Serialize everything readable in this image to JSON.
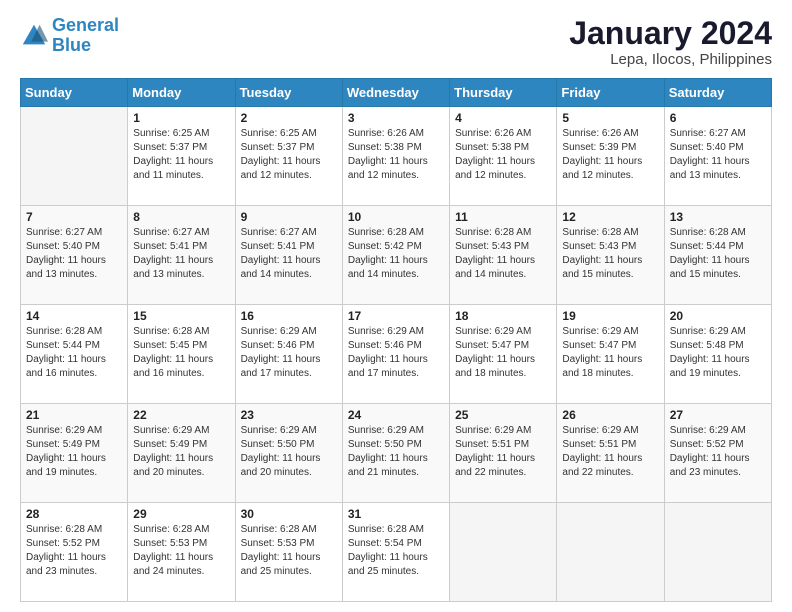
{
  "logo": {
    "line1": "General",
    "line2": "Blue"
  },
  "title": "January 2024",
  "subtitle": "Lepa, Ilocos, Philippines",
  "days_header": [
    "Sunday",
    "Monday",
    "Tuesday",
    "Wednesday",
    "Thursday",
    "Friday",
    "Saturday"
  ],
  "weeks": [
    [
      {
        "day": "",
        "content": ""
      },
      {
        "day": "1",
        "content": "Sunrise: 6:25 AM\nSunset: 5:37 PM\nDaylight: 11 hours\nand 11 minutes."
      },
      {
        "day": "2",
        "content": "Sunrise: 6:25 AM\nSunset: 5:37 PM\nDaylight: 11 hours\nand 12 minutes."
      },
      {
        "day": "3",
        "content": "Sunrise: 6:26 AM\nSunset: 5:38 PM\nDaylight: 11 hours\nand 12 minutes."
      },
      {
        "day": "4",
        "content": "Sunrise: 6:26 AM\nSunset: 5:38 PM\nDaylight: 11 hours\nand 12 minutes."
      },
      {
        "day": "5",
        "content": "Sunrise: 6:26 AM\nSunset: 5:39 PM\nDaylight: 11 hours\nand 12 minutes."
      },
      {
        "day": "6",
        "content": "Sunrise: 6:27 AM\nSunset: 5:40 PM\nDaylight: 11 hours\nand 13 minutes."
      }
    ],
    [
      {
        "day": "7",
        "content": "Sunrise: 6:27 AM\nSunset: 5:40 PM\nDaylight: 11 hours\nand 13 minutes."
      },
      {
        "day": "8",
        "content": "Sunrise: 6:27 AM\nSunset: 5:41 PM\nDaylight: 11 hours\nand 13 minutes."
      },
      {
        "day": "9",
        "content": "Sunrise: 6:27 AM\nSunset: 5:41 PM\nDaylight: 11 hours\nand 14 minutes."
      },
      {
        "day": "10",
        "content": "Sunrise: 6:28 AM\nSunset: 5:42 PM\nDaylight: 11 hours\nand 14 minutes."
      },
      {
        "day": "11",
        "content": "Sunrise: 6:28 AM\nSunset: 5:43 PM\nDaylight: 11 hours\nand 14 minutes."
      },
      {
        "day": "12",
        "content": "Sunrise: 6:28 AM\nSunset: 5:43 PM\nDaylight: 11 hours\nand 15 minutes."
      },
      {
        "day": "13",
        "content": "Sunrise: 6:28 AM\nSunset: 5:44 PM\nDaylight: 11 hours\nand 15 minutes."
      }
    ],
    [
      {
        "day": "14",
        "content": "Sunrise: 6:28 AM\nSunset: 5:44 PM\nDaylight: 11 hours\nand 16 minutes."
      },
      {
        "day": "15",
        "content": "Sunrise: 6:28 AM\nSunset: 5:45 PM\nDaylight: 11 hours\nand 16 minutes."
      },
      {
        "day": "16",
        "content": "Sunrise: 6:29 AM\nSunset: 5:46 PM\nDaylight: 11 hours\nand 17 minutes."
      },
      {
        "day": "17",
        "content": "Sunrise: 6:29 AM\nSunset: 5:46 PM\nDaylight: 11 hours\nand 17 minutes."
      },
      {
        "day": "18",
        "content": "Sunrise: 6:29 AM\nSunset: 5:47 PM\nDaylight: 11 hours\nand 18 minutes."
      },
      {
        "day": "19",
        "content": "Sunrise: 6:29 AM\nSunset: 5:47 PM\nDaylight: 11 hours\nand 18 minutes."
      },
      {
        "day": "20",
        "content": "Sunrise: 6:29 AM\nSunset: 5:48 PM\nDaylight: 11 hours\nand 19 minutes."
      }
    ],
    [
      {
        "day": "21",
        "content": "Sunrise: 6:29 AM\nSunset: 5:49 PM\nDaylight: 11 hours\nand 19 minutes."
      },
      {
        "day": "22",
        "content": "Sunrise: 6:29 AM\nSunset: 5:49 PM\nDaylight: 11 hours\nand 20 minutes."
      },
      {
        "day": "23",
        "content": "Sunrise: 6:29 AM\nSunset: 5:50 PM\nDaylight: 11 hours\nand 20 minutes."
      },
      {
        "day": "24",
        "content": "Sunrise: 6:29 AM\nSunset: 5:50 PM\nDaylight: 11 hours\nand 21 minutes."
      },
      {
        "day": "25",
        "content": "Sunrise: 6:29 AM\nSunset: 5:51 PM\nDaylight: 11 hours\nand 22 minutes."
      },
      {
        "day": "26",
        "content": "Sunrise: 6:29 AM\nSunset: 5:51 PM\nDaylight: 11 hours\nand 22 minutes."
      },
      {
        "day": "27",
        "content": "Sunrise: 6:29 AM\nSunset: 5:52 PM\nDaylight: 11 hours\nand 23 minutes."
      }
    ],
    [
      {
        "day": "28",
        "content": "Sunrise: 6:28 AM\nSunset: 5:52 PM\nDaylight: 11 hours\nand 23 minutes."
      },
      {
        "day": "29",
        "content": "Sunrise: 6:28 AM\nSunset: 5:53 PM\nDaylight: 11 hours\nand 24 minutes."
      },
      {
        "day": "30",
        "content": "Sunrise: 6:28 AM\nSunset: 5:53 PM\nDaylight: 11 hours\nand 25 minutes."
      },
      {
        "day": "31",
        "content": "Sunrise: 6:28 AM\nSunset: 5:54 PM\nDaylight: 11 hours\nand 25 minutes."
      },
      {
        "day": "",
        "content": ""
      },
      {
        "day": "",
        "content": ""
      },
      {
        "day": "",
        "content": ""
      }
    ]
  ]
}
